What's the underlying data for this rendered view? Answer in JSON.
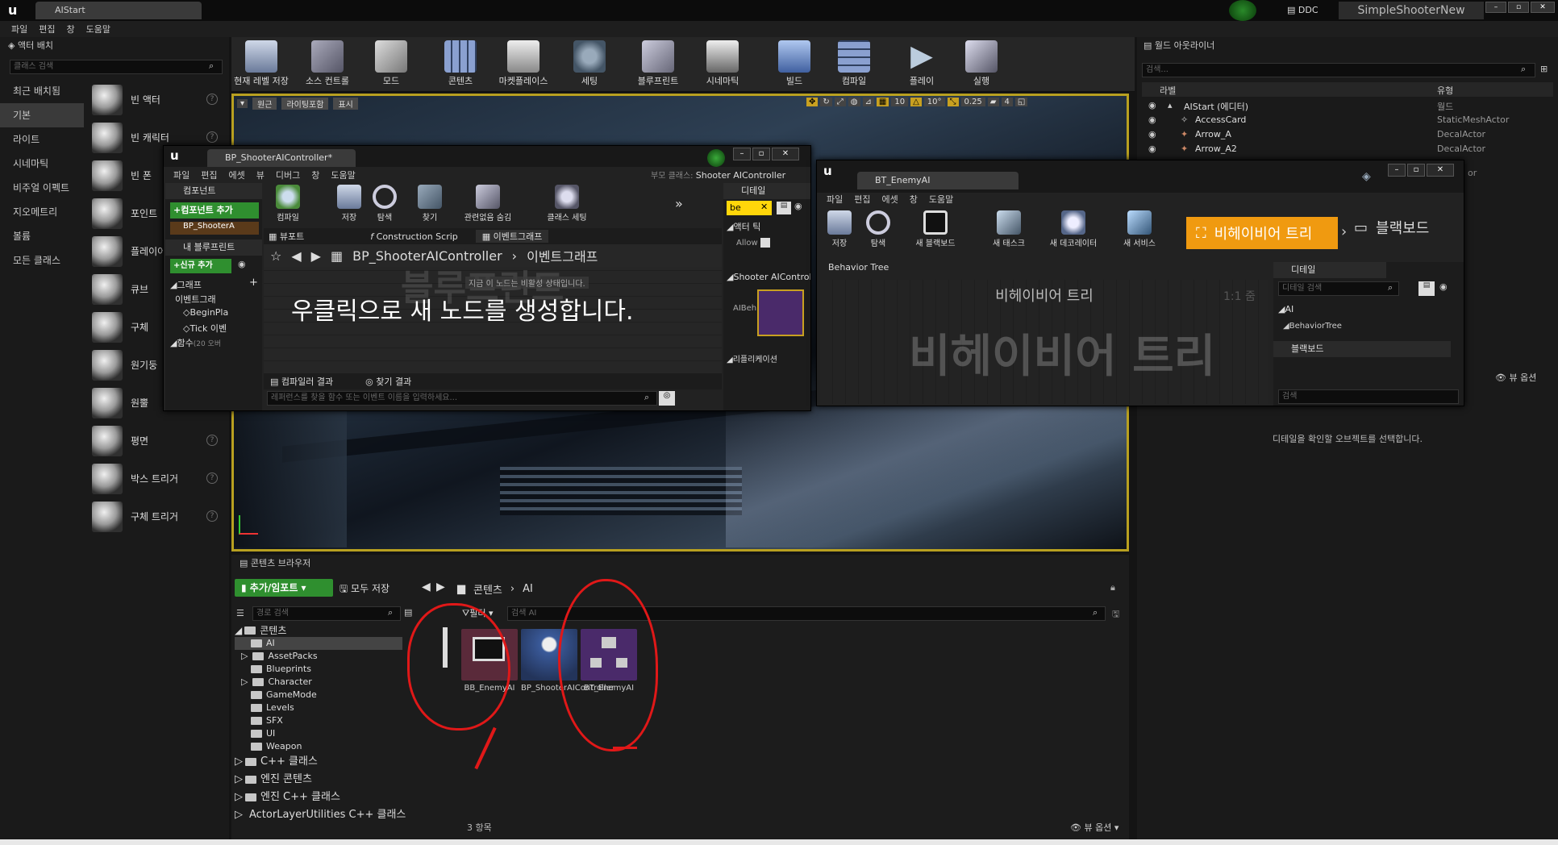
{
  "title_bar": {
    "app_tab": "AIStart",
    "ddc": "DDC",
    "project": "SimpleShooterNew"
  },
  "menu": [
    "파일",
    "편집",
    "창",
    "도움말"
  ],
  "place_actors": {
    "tab": "액터 배치",
    "search_placeholder": "클래스 검색",
    "categories": [
      "최근 배치됨",
      "기본",
      "라이트",
      "시네마틱",
      "비주얼 이펙트",
      "지오메트리",
      "볼륨",
      "모든 클래스"
    ],
    "selected_category": "기본",
    "items": [
      "빈 액터",
      "빈 캐릭터",
      "빈 폰",
      "포인트",
      "플레이어",
      "큐브",
      "구체",
      "원기둥",
      "원뿔",
      "평면",
      "박스 트리거",
      "구체 트리거"
    ]
  },
  "toolbar": [
    "현재 레벨 저장",
    "소스 컨트롤",
    "모드",
    "콘텐츠",
    "마켓플레이스",
    "세팅",
    "블루프린트",
    "시네마틱",
    "빌드",
    "컴파일",
    "플레이",
    "실행"
  ],
  "viewport_bar": {
    "perspective": "원근",
    "lit": "라이팅포함",
    "show": "표시",
    "grid": "10",
    "angle": "10°",
    "scale": "0.25",
    "speed": "4"
  },
  "outliner": {
    "tab": "월드 아웃라이너",
    "search_placeholder": "검색...",
    "col_label": "라벨",
    "col_type": "유형",
    "rows": [
      {
        "label": "AIStart (에디터)",
        "type": "월드"
      },
      {
        "label": "AccessCard",
        "type": "StaticMeshActor"
      },
      {
        "label": "Arrow_A",
        "type": "DecalActor"
      },
      {
        "label": "Arrow_A2",
        "type": "DecalActor"
      }
    ],
    "partial_type": "or",
    "view_options": "뷰 옵션"
  },
  "details_main": {
    "tab": "디테일",
    "empty": "디테일을 확인할 오브젝트를 선택합니다."
  },
  "bp_window": {
    "tab": "BP_ShooterAIController*",
    "menu": [
      "파일",
      "편집",
      "에셋",
      "뷰",
      "디버그",
      "창",
      "도움말"
    ],
    "parent_label": "부모 클래스:",
    "parent_value": "Shooter AIController",
    "toolbar": [
      "컴파일",
      "저장",
      "탐색",
      "찾기",
      "관련없음 숨김",
      "클래스 세팅"
    ],
    "components": "컴포넌트",
    "add_component": "+컴포넌트 추가",
    "component_item": "BP_ShooterA",
    "my_blueprint": "내 블루프린트",
    "add_new": "+신규 추가",
    "graph": "그래프",
    "event_graph": "이벤트그래",
    "begin_play": "BeginPla",
    "tick": "Tick 이벤",
    "functions": "함수",
    "functions_count": "(20 오버",
    "tab_viewport": "뷰포트",
    "tab_construction": "Construction Scrip",
    "tab_eventgraph": "이벤트그래프",
    "breadcrumb_root": "BP_ShooterAIController",
    "breadcrumb_leaf": "이벤트그래프",
    "watermark": "블루프린트",
    "hint": "우클릭으로 새 노드를 생성합니다.",
    "tooltip": "지금 이 노드는 비활성 상태입니다.",
    "compiler_results": "컴파일러 결과",
    "find_results": "찾기 결과",
    "find_placeholder": "레퍼런스를 찾을 함수 또는 이벤트 이름을 입력하세요...",
    "details": "디테일",
    "details_search": "be",
    "actor_tick": "액터 틱",
    "allow": "Allow",
    "shooter_section": "Shooter AIControlle",
    "aibeh": "AIBeh",
    "replication": "리플리케이션"
  },
  "bt_window": {
    "tab": "BT_EnemyAI",
    "menu": [
      "파일",
      "편집",
      "에셋",
      "창",
      "도움말"
    ],
    "toolbar": [
      "저장",
      "탐색",
      "새 블랙보드",
      "새 태스크",
      "새 데코레이터",
      "새 서비스"
    ],
    "mode_bt": "비헤이비어 트리",
    "mode_bb": "블랙보드",
    "panel_tab": "Behavior Tree",
    "graph_title": "비헤이비어 트리",
    "zoom": "1:1 줌",
    "watermark": "비헤이비어 트리",
    "details": "디테일",
    "details_search": "디테일 검색",
    "ai": "AI",
    "behavior_tree": "BehaviorTree",
    "blackboard": "블랙보드",
    "bb_search": "검색"
  },
  "content_browser": {
    "tab": "콘텐츠 브라우저",
    "add_import": "추가/임포트",
    "save_all": "모두 저장",
    "path": [
      "콘텐츠",
      "AI"
    ],
    "path_search": "경로 검색",
    "filter": "필터",
    "search_placeholder": "검색 AI",
    "tree_root": "콘텐츠",
    "folders": [
      "AI",
      "AssetPacks",
      "Blueprints",
      "Character",
      "GameMode",
      "Levels",
      "SFX",
      "UI",
      "Weapon"
    ],
    "more": [
      "C++ 클래스",
      "엔진 콘텐츠",
      "엔진 C++ 클래스",
      "ActorLayerUtilities C++ 클래스"
    ],
    "assets": [
      "BB_EnemyAI",
      "BP_ShooterAIController",
      "BT_EnemyAI"
    ],
    "count": "3 항목",
    "view_options": "뷰 옵션"
  }
}
